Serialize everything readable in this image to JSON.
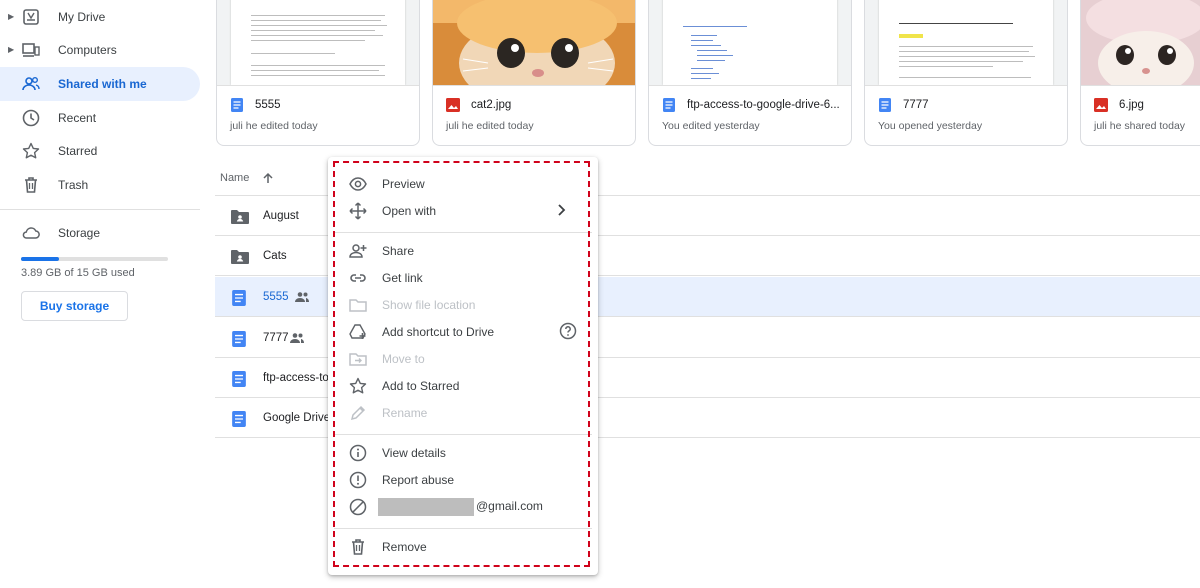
{
  "sidebar": {
    "items": [
      {
        "label": "My Drive",
        "icon": "my-drive-icon"
      },
      {
        "label": "Computers",
        "icon": "computers-icon"
      },
      {
        "label": "Shared with me",
        "icon": "shared-icon"
      },
      {
        "label": "Recent",
        "icon": "clock-icon"
      },
      {
        "label": "Starred",
        "icon": "star-icon"
      },
      {
        "label": "Trash",
        "icon": "trash-icon"
      }
    ],
    "storage_label": "Storage",
    "storage_used_text": "3.89 GB of 15 GB used",
    "storage_fraction": 0.26,
    "buy_storage": "Buy storage"
  },
  "cards": [
    {
      "name": "5555",
      "meta": "juli he edited today",
      "type": "doc"
    },
    {
      "name": "cat2.jpg",
      "meta": "juli he edited today",
      "type": "image"
    },
    {
      "name": "ftp-access-to-google-drive-6...",
      "meta": "You edited yesterday",
      "type": "doc"
    },
    {
      "name": "7777",
      "meta": "You opened yesterday",
      "type": "doc"
    },
    {
      "name": "6.jpg",
      "meta": "juli he shared today",
      "type": "image"
    }
  ],
  "list": {
    "header": "Name",
    "rows": [
      {
        "name": "August",
        "type": "folder"
      },
      {
        "name": "Cats",
        "type": "folder"
      },
      {
        "name": "5555",
        "type": "doc"
      },
      {
        "name": "7777",
        "type": "doc"
      },
      {
        "name": "ftp-access-to",
        "type": "doc"
      },
      {
        "name": "Google Drive's",
        "type": "doc"
      }
    ]
  },
  "menu": {
    "preview": "Preview",
    "open_with": "Open with",
    "share": "Share",
    "get_link": "Get link",
    "show_file_location": "Show file location",
    "add_shortcut": "Add shortcut to Drive",
    "move_to": "Move to",
    "add_to_starred": "Add to Starred",
    "rename": "Rename",
    "view_details": "View details",
    "report_abuse": "Report abuse",
    "block_email_suffix": "@gmail.com",
    "remove": "Remove"
  },
  "colors": {
    "accent": "#1a73e8",
    "doc_blue": "#4285f4",
    "image_red": "#d93025",
    "selected_bg": "#e8f0fe",
    "annotation_red": "#d0021b"
  }
}
